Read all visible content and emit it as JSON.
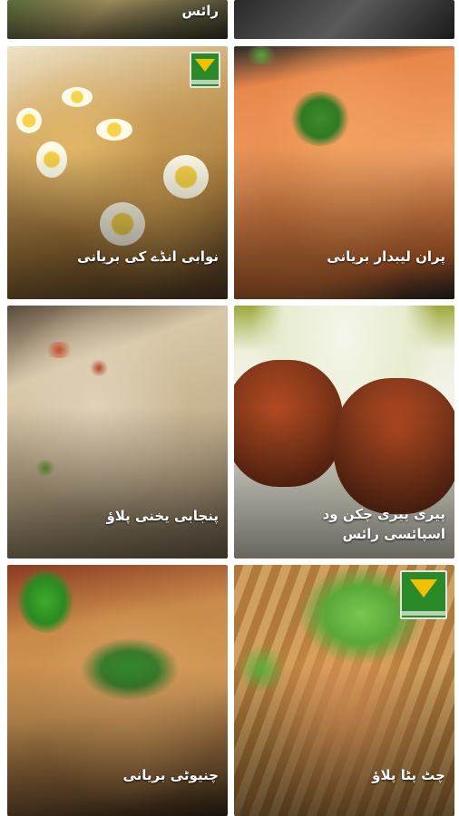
{
  "recipes": [
    {
      "title": "رائس",
      "logo": false
    },
    {
      "title": "",
      "logo": false
    },
    {
      "title": "نوابی انڈے کی بریانی",
      "logo": true
    },
    {
      "title": "پران لیبدار بریانی",
      "logo": false
    },
    {
      "title": "پنجابی یخنی پلاؤ",
      "logo": false
    },
    {
      "title": "پیری پیری چکن ود اسپائسی رائس",
      "logo": false
    },
    {
      "title": "چنیوٹی بریانی",
      "logo": false
    },
    {
      "title": "چٹ پٹا پلاؤ",
      "logo": true
    }
  ],
  "colors": {
    "background": "#ffffff",
    "label_text": "#ffffff",
    "logo_green": "#2a8a2a",
    "logo_yellow": "#f2c200"
  }
}
